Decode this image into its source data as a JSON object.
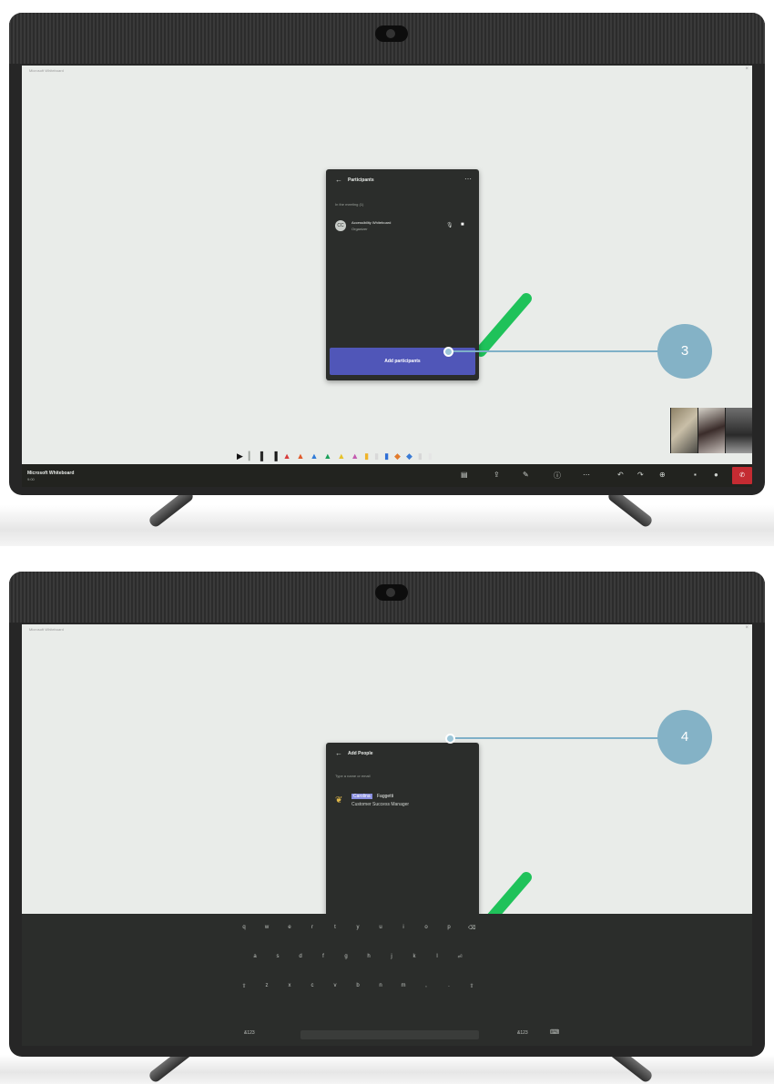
{
  "app": {
    "name": "Microsoft Whiteboard",
    "time": "9:00"
  },
  "step3": {
    "callout": "3",
    "panel_title": "Participants",
    "section": "In the meeting (1)",
    "participant": {
      "initials": "CC",
      "name": "Accessibility Whiteboard",
      "role": "Organizer"
    },
    "add_button": "Add participants"
  },
  "step4": {
    "callout": "4",
    "panel_title": "Add People",
    "search_hint": "Type a name or email",
    "suggestion": {
      "first": "Carolina",
      "last": "Faggetti",
      "title": "Customer Success Manager"
    }
  },
  "toolbar_colors": [
    "#111111",
    "#9aa09a",
    "#2b2b2b",
    "#1a1a1a",
    "#d83b3b",
    "#e05a2a",
    "#2f7bd8",
    "#1aa05a",
    "#e6c229",
    "#e0e0e0",
    "#c45ab0",
    "#d9d9d9",
    "#f0b429",
    "#e8e8e8",
    "#2f6fd6",
    "#d7d7d7",
    "#e27b2c",
    "#3a7bd5",
    "#f1f1f1",
    "#e5e5e5"
  ],
  "accent": "#5056b8",
  "callout_color": "#84b2c6",
  "hangup_color": "#c42b32",
  "keyboard_rows": [
    [
      "q",
      "w",
      "e",
      "r",
      "t",
      "y",
      "u",
      "i",
      "o",
      "p",
      "⌫"
    ],
    [
      "a",
      "s",
      "d",
      "f",
      "g",
      "h",
      "j",
      "k",
      "l",
      "⏎"
    ],
    [
      "⇧",
      "z",
      "x",
      "c",
      "v",
      "b",
      "n",
      "m",
      ",",
      ".",
      "⇧"
    ]
  ],
  "keyboard_left": "&123",
  "keyboard_right": "&123"
}
